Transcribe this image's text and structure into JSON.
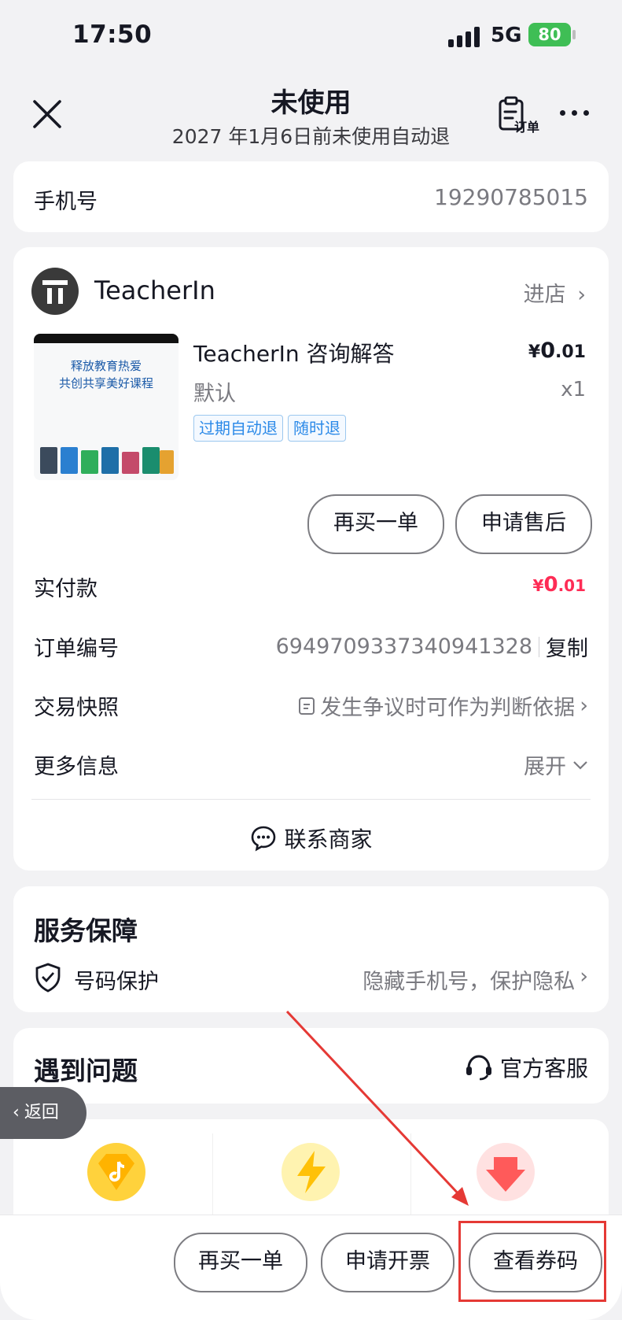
{
  "status_bar": {
    "time": "17:50",
    "network": "5G",
    "battery": "80"
  },
  "header": {
    "title": "未使用",
    "subtitle": "2027 年1月6日前未使用自动退",
    "order_label": "订单"
  },
  "phone": {
    "label": "手机号",
    "value": "19290785015"
  },
  "shop": {
    "name": "TeacherIn",
    "enter_label": "进店"
  },
  "product": {
    "thumbnail_line1": "释放教育热爱",
    "thumbnail_line2": "共创共享美好课程",
    "title": "TeacherIn 咨询解答",
    "price_currency": "¥",
    "price_int": "0",
    "price_dec": ".01",
    "spec": "默认",
    "quantity": "x1",
    "tags": [
      "过期自动退",
      "随时退"
    ]
  },
  "product_actions": {
    "rebuy": "再买一单",
    "after_sale": "申请售后"
  },
  "details": {
    "paid_label": "实付款",
    "paid_currency": "¥",
    "paid_int": "0",
    "paid_dec": ".01",
    "order_no_label": "订单编号",
    "order_no": "6949709337340941328",
    "copy_label": "复制",
    "snapshot_label": "交易快照",
    "snapshot_value": "发生争议时可作为判断依据",
    "more_label": "更多信息",
    "more_value": "展开"
  },
  "contact_label": "联系商家",
  "service": {
    "title": "服务保障",
    "item_label": "号码保护",
    "item_value": "隐藏手机号，保护隐私"
  },
  "problems": {
    "title": "遇到问题",
    "cs_label": "官方客服"
  },
  "back_label": "返回",
  "bottom_actions": {
    "rebuy": "再买一单",
    "invoice": "申请开票",
    "view_code": "查看券码"
  },
  "colors": {
    "accent_red": "#fe2c55",
    "tag_blue": "#2c8ae8",
    "annotation_red": "#e53935"
  }
}
